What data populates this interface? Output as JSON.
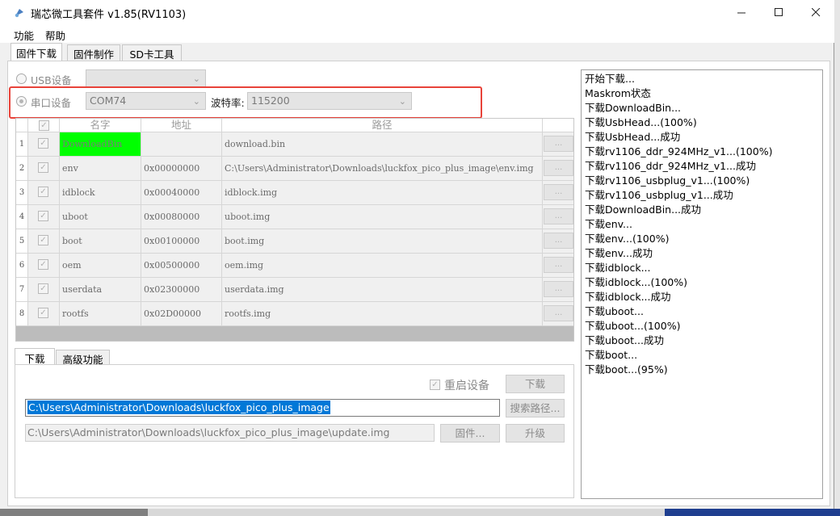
{
  "window": {
    "title": "瑞芯微工具套件 v1.85(RV1103)",
    "minimize_icon": "minimize-icon",
    "maximize_icon": "maximize-icon",
    "close_icon": "close-icon"
  },
  "menu": {
    "items": [
      "功能",
      "帮助"
    ]
  },
  "main_tabs": [
    "固件下载",
    "固件制作",
    "SD卡工具"
  ],
  "device": {
    "usb_label": "USB设备",
    "usb_value": "",
    "serial_label": "串口设备",
    "serial_value": "COM74",
    "baud_label": "波特率:",
    "baud_value": "115200"
  },
  "table": {
    "columns": [
      "",
      "名字",
      "地址",
      "路径",
      ""
    ],
    "rows": [
      {
        "num": "1",
        "name": "DownloadBin",
        "address": "",
        "path": "download.bin",
        "browse": "..."
      },
      {
        "num": "2",
        "name": "env",
        "address": "0x00000000",
        "path": "C:\\Users\\Administrator\\Downloads\\luckfox_pico_plus_image\\env.img",
        "browse": "..."
      },
      {
        "num": "3",
        "name": "idblock",
        "address": "0x00040000",
        "path": "idblock.img",
        "browse": "..."
      },
      {
        "num": "4",
        "name": "uboot",
        "address": "0x00080000",
        "path": "uboot.img",
        "browse": "..."
      },
      {
        "num": "5",
        "name": "boot",
        "address": "0x00100000",
        "path": "boot.img",
        "browse": "..."
      },
      {
        "num": "6",
        "name": "oem",
        "address": "0x00500000",
        "path": "oem.img",
        "browse": "..."
      },
      {
        "num": "7",
        "name": "userdata",
        "address": "0x02300000",
        "path": "userdata.img",
        "browse": "..."
      },
      {
        "num": "8",
        "name": "rootfs",
        "address": "0x02D00000",
        "path": "rootfs.img",
        "browse": "..."
      }
    ]
  },
  "lower_tabs": [
    "下载",
    "高级功能"
  ],
  "download_panel": {
    "restart_label": "重启设备",
    "download_button": "下载",
    "path_value": "C:\\Users\\Administrator\\Downloads\\luckfox_pico_plus_image",
    "search_path_button": "搜索路径...",
    "firmware_value": "C:\\Users\\Administrator\\Downloads\\luckfox_pico_plus_image\\update.img",
    "firmware_button": "固件...",
    "upgrade_button": "升级"
  },
  "log": [
    "开始下载...",
    "Maskrom状态",
    "下载DownloadBin...",
    "下载UsbHead...(100%)",
    "下载UsbHead...成功",
    "下载rv1106_ddr_924MHz_v1...(100%)",
    "下载rv1106_ddr_924MHz_v1...成功",
    "下载rv1106_usbplug_v1...(100%)",
    "下载rv1106_usbplug_v1...成功",
    "下载DownloadBin...成功",
    "下载env...",
    "下载env...(100%)",
    "下载env...成功",
    "下载idblock...",
    "下载idblock...(100%)",
    "下载idblock...成功",
    "下载uboot...",
    "下载uboot...(100%)",
    "下载uboot...成功",
    "下载boot...",
    "下载boot...(95%)"
  ],
  "colors": {
    "highlight_row_name": "#00ff00",
    "selection_blue": "#0078d7",
    "annotation_red": "#e8433a"
  }
}
